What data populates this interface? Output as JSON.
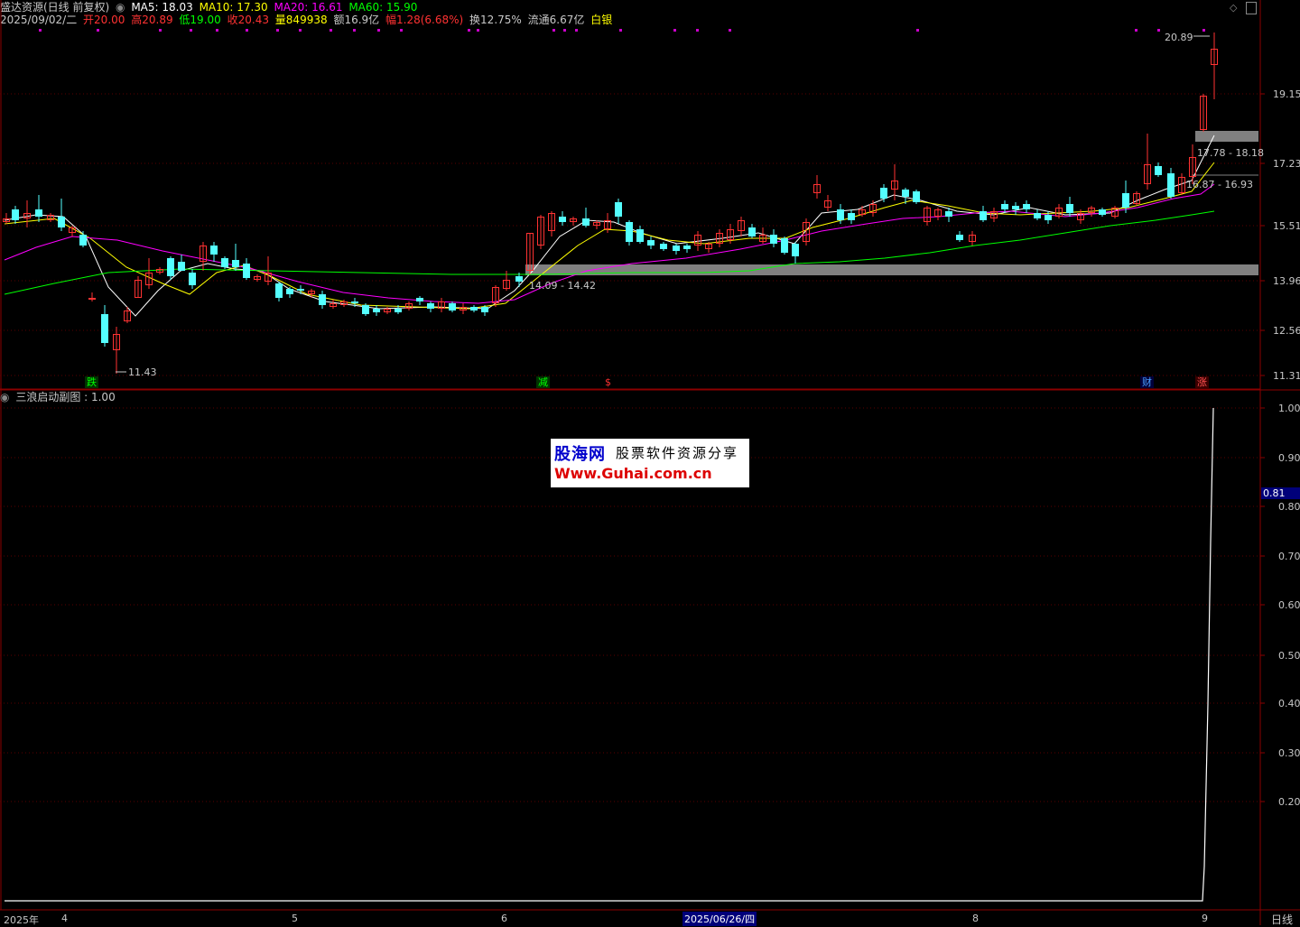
{
  "header": {
    "stock_title": "盛达资源(日线 前复权)",
    "ma5": "MA5: 18.03",
    "ma10": "MA10: 17.30",
    "ma20": "MA20: 16.61",
    "ma60": "MA60: 15.90",
    "date": "2025/09/02/二",
    "open": "开20.00",
    "high": "高20.89",
    "low": "低19.00",
    "close": "收20.43",
    "volume": "量849938",
    "amount": "额16.9亿",
    "change": "幅1.28(6.68%)",
    "turnover": "换12.75%",
    "float_cap": "流通6.67亿",
    "sector": "白银"
  },
  "sub_panel": {
    "title": "三浪启动副图 : 1.00",
    "current_value": "0.81"
  },
  "price_axis": [
    "19.15",
    "17.23",
    "15.51",
    "13.96",
    "12.56",
    "11.31"
  ],
  "sub_axis": [
    "1.00",
    "0.90",
    "0.80",
    "0.70",
    "0.60",
    "0.50",
    "0.40",
    "0.30",
    "0.20"
  ],
  "time_axis": {
    "year": "2025年",
    "months": [
      "4",
      "5",
      "6",
      "8",
      "9"
    ],
    "cursor_date": "2025/06/26/四",
    "period": "日线"
  },
  "annotations": {
    "high_mark": "20.89",
    "low_mark": "11.43",
    "zone1": "14.09 - 14.42",
    "zone2": "17.78 - 18.18",
    "zone3": "16.87 - 16.93"
  },
  "tags": {
    "die": "跌",
    "jian": "减",
    "dollar": "$",
    "cai": "财",
    "zhang": "涨"
  },
  "watermark": {
    "brand": "股海网",
    "slogan": "股票软件资源分享",
    "url": "Www.Guhai.com.cn"
  },
  "colors": {
    "up": "#ff3232",
    "down": "#54ffff",
    "ma5": "#ffffff",
    "ma10": "#ffff00",
    "ma20": "#ff00ff",
    "ma60": "#00ff00",
    "grid": "#8b0000"
  }
}
